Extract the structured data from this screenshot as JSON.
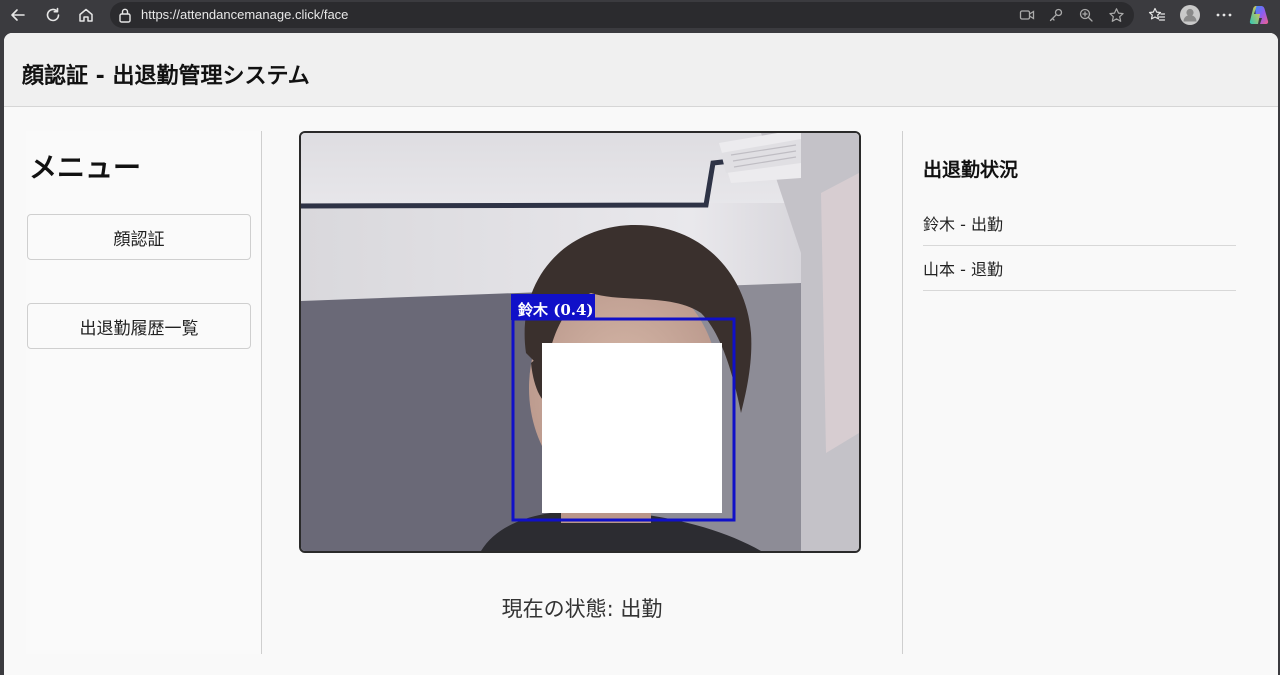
{
  "browser": {
    "url": "https://attendancemanage.click/face",
    "icons": [
      "back-icon",
      "reload-icon",
      "home-icon",
      "lock-icon",
      "camera-icon",
      "key-icon",
      "zoom-icon",
      "star-icon",
      "favorites-icon",
      "profile-icon",
      "more-icon",
      "copilot-icon"
    ]
  },
  "header": {
    "title": "顔認証 - 出退勤管理システム"
  },
  "sidebar": {
    "title": "メニュー",
    "items": [
      {
        "label": "顔認証"
      },
      {
        "label": "出退勤履歴一覧"
      }
    ]
  },
  "camera": {
    "detection_label": "鈴木 (0.4)",
    "detection_color": "#1010c8"
  },
  "status": {
    "text": "現在の状態: 出勤"
  },
  "attendance": {
    "title": "出退勤状況",
    "records": [
      {
        "text": "鈴木 - 出勤"
      },
      {
        "text": "山本 - 退勤"
      }
    ]
  }
}
